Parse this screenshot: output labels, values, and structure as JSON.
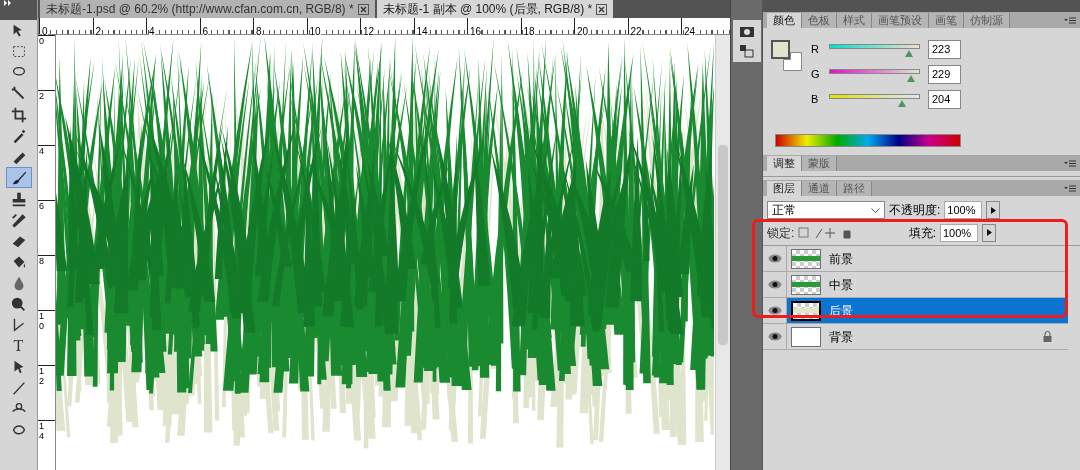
{
  "document_tabs": [
    {
      "title": "未标题-1.psd @ 60.2% (http://www.cfan.com.cn, RGB/8) *",
      "selected": false
    },
    {
      "title": "未标题-1 副本 @ 100% (后景, RGB/8) *",
      "selected": true
    }
  ],
  "tools": [
    {
      "selected": false
    },
    {
      "selected": false
    },
    {
      "selected": false
    },
    {
      "selected": false
    },
    {
      "selected": false
    },
    {
      "selected": false
    },
    {
      "selected": false
    },
    {
      "selected": true
    },
    {
      "selected": false
    },
    {
      "selected": false
    },
    {
      "selected": false
    },
    {
      "selected": false
    },
    {
      "selected": false
    },
    {
      "selected": false
    },
    {
      "selected": false
    },
    {
      "selected": false
    },
    {
      "selected": false
    },
    {
      "selected": false
    },
    {
      "selected": false
    },
    {
      "selected": false
    }
  ],
  "type_tool_label": "T",
  "horizontal_ruler": [
    "0",
    "2",
    "4",
    "6",
    "8",
    "10",
    "12",
    "14",
    "16",
    "18",
    "20",
    "22",
    "24"
  ],
  "vertical_ruler": [
    "0",
    "2",
    "4",
    "6",
    "8",
    "10",
    "12",
    "14"
  ],
  "color_panel": {
    "tabs": [
      {
        "label": "颜色",
        "selected": true
      },
      {
        "label": "色板",
        "selected": false
      },
      {
        "label": "样式",
        "selected": false
      },
      {
        "label": "画笔预设",
        "selected": false
      },
      {
        "label": "画笔",
        "selected": false
      },
      {
        "label": "仿制源",
        "selected": false
      }
    ],
    "channels": [
      {
        "name": "R",
        "level": 0.875,
        "value": "223"
      },
      {
        "name": "G",
        "level": 0.898,
        "value": "229"
      },
      {
        "name": "B",
        "level": 0.8,
        "value": "204"
      }
    ]
  },
  "adjust_panel": {
    "tabs": [
      {
        "label": "调整",
        "selected": true
      },
      {
        "label": "蒙版",
        "selected": false
      }
    ]
  },
  "layers_panel": {
    "tabs": [
      {
        "label": "图层",
        "selected": true
      },
      {
        "label": "通道",
        "selected": false
      },
      {
        "label": "路径",
        "selected": false
      }
    ],
    "blend_mode": "正常",
    "opacity_label": "不透明度:",
    "opacity": "100%",
    "lock_label": "锁定:",
    "fill_label": "填充:",
    "fill": "100%",
    "layers": [
      {
        "name": "前景",
        "visible": true,
        "selected": false,
        "locked": false,
        "kind": "grass"
      },
      {
        "name": "中景",
        "visible": true,
        "selected": false,
        "locked": false,
        "kind": "grass"
      },
      {
        "name": "后景",
        "visible": true,
        "selected": true,
        "locked": false,
        "kind": "pale"
      },
      {
        "name": "背景",
        "visible": true,
        "selected": false,
        "locked": true,
        "kind": "white"
      }
    ]
  }
}
